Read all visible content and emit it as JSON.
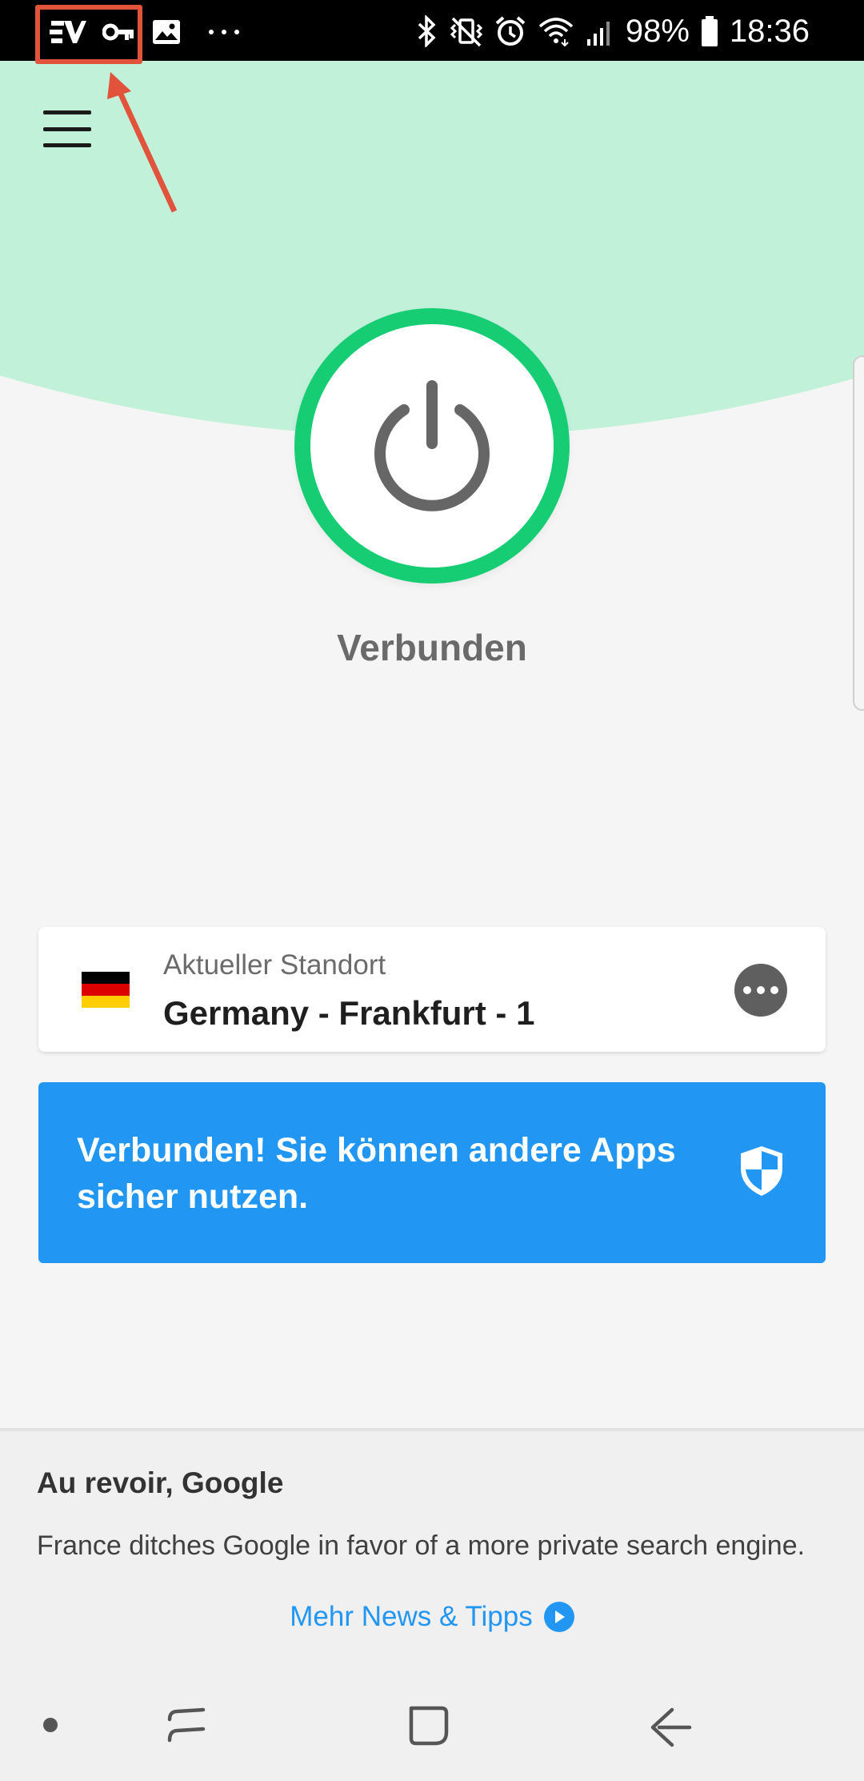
{
  "status_bar": {
    "battery": "98%",
    "time": "18:36",
    "left_icons": [
      "expressvpn-icon",
      "vpn-key-icon",
      "image-icon",
      "more-notifications-icon"
    ],
    "right_icons": [
      "bluetooth-icon",
      "vibrate-icon",
      "alarm-icon",
      "wifi-icon",
      "signal-icon",
      "battery-icon"
    ]
  },
  "header": {
    "menu_icon": "hamburger-menu-icon"
  },
  "connection": {
    "status": "Verbunden",
    "power_icon": "power-icon",
    "ring_color": "#17cd73"
  },
  "location": {
    "label": "Aktueller Standort",
    "name": "Germany - Frankfurt - 1",
    "flag": "germany-flag",
    "more_icon": "more-options-icon"
  },
  "banner": {
    "text": "Verbunden! Sie können andere Apps sicher nutzen.",
    "icon": "shield-icon",
    "color": "#2196f3"
  },
  "news": {
    "title": "Au revoir, Google",
    "body": "France ditches Google in favor of a more private search engine.",
    "link": "Mehr News & Tipps",
    "link_icon": "play-circle-icon"
  },
  "colors": {
    "mint": "#c2f1da",
    "accent_blue": "#2196f3",
    "annotation_red": "#e2533b"
  }
}
